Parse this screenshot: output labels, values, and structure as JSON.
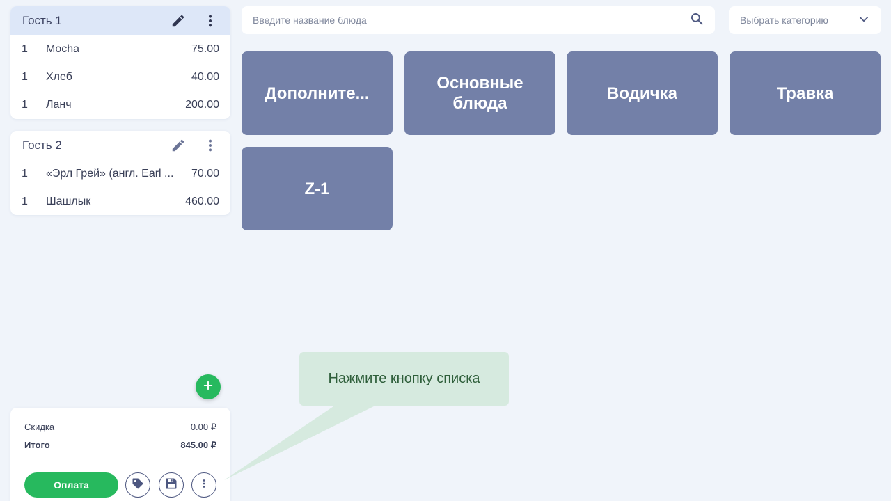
{
  "guests": [
    {
      "name": "Гость 1",
      "items": [
        {
          "qty": "1",
          "name": "Mocha",
          "price": "75.00"
        },
        {
          "qty": "1",
          "name": "Хлеб",
          "price": "40.00"
        },
        {
          "qty": "1",
          "name": "Ланч",
          "price": "200.00"
        }
      ]
    },
    {
      "name": "Гость 2",
      "items": [
        {
          "qty": "1",
          "name": "«Эрл Грей» (англ. Earl ...",
          "price": "70.00"
        },
        {
          "qty": "1",
          "name": "Шашлык",
          "price": "460.00"
        }
      ]
    }
  ],
  "search": {
    "placeholder": "Введите название блюда"
  },
  "category": {
    "label": "Выбрать категорию"
  },
  "categories": [
    {
      "label": "Дополните..."
    },
    {
      "label": "Основные блюда"
    },
    {
      "label": "Водичка"
    },
    {
      "label": "Травка"
    },
    {
      "label": "Z-1"
    }
  ],
  "totals": {
    "discount_label": "Скидка",
    "discount_value": "0.00 ₽",
    "total_label": "Итого",
    "total_value": "845.00 ₽"
  },
  "actions": {
    "pay_label": "Оплата"
  },
  "tooltip": {
    "text": "Нажмите кнопку списка"
  },
  "colors": {
    "accent_green": "#27b95e",
    "tile": "#7380a8",
    "selected_header": "#dde7f8",
    "tooltip_bg": "#d6eadf"
  },
  "icons": [
    "pencil-icon",
    "more-vert-icon",
    "search-icon",
    "chevron-down-icon",
    "plus-icon",
    "tag-icon",
    "save-icon"
  ]
}
